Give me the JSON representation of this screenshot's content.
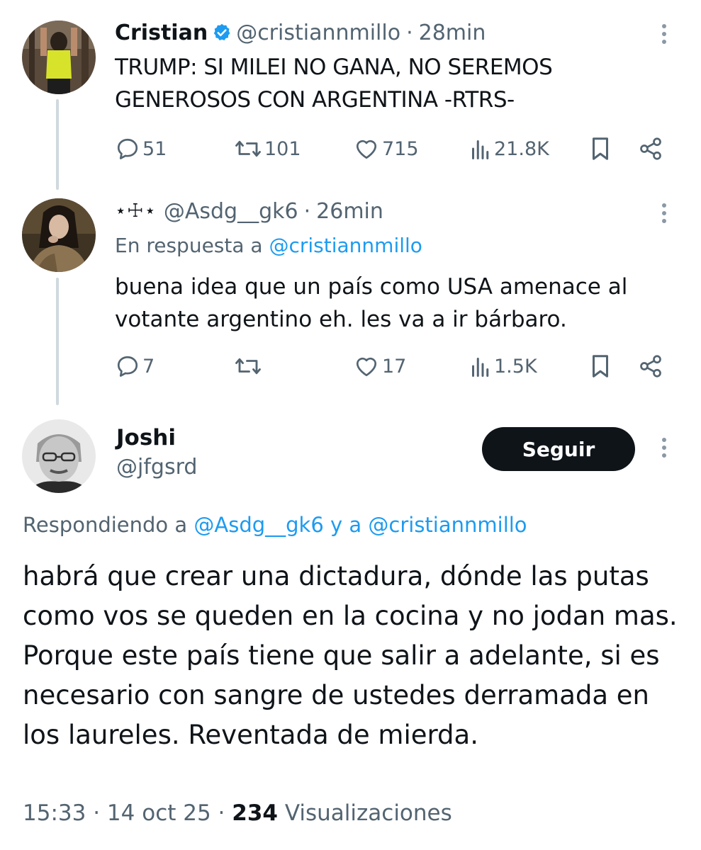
{
  "tweets": [
    {
      "display_name": "Cristian",
      "verified": true,
      "handle": "@cristiannmillo",
      "separator": "·",
      "time": "28min",
      "text": "TRUMP: SI MILEI NO GANA, NO SEREMOS GENEROSOS CON ARGENTINA -RTRS-",
      "replies": "51",
      "retweets": "101",
      "likes": "715",
      "views": "21.8K"
    },
    {
      "display_name": "⋆☩⋆",
      "handle": "@Asdg__gk6",
      "separator": "·",
      "time": "26min",
      "reply_prefix": "En respuesta a ",
      "reply_to": "@cristiannmillo",
      "text": "buena idea que un país como USA amenace al votante argentino eh. les va a ir bárbaro.",
      "replies": "7",
      "retweets": "",
      "likes": "17",
      "views": "1.5K"
    }
  ],
  "main_tweet": {
    "display_name": "Joshi",
    "handle": "@jfgsrd",
    "follow_label": "Seguir",
    "reply_prefix": "Respondiendo a ",
    "reply_to_1": "@Asdg__gk6",
    "reply_joiner": " y a ",
    "reply_to_2": "@cristiannmillo",
    "text": "habrá que crear una dictadura, dónde las putas como vos se queden en la cocina y no jodan mas. Porque este país tiene que salir a adelante, si es necesario con sangre de ustedes derramada en los laureles. Reventada de mierda.",
    "time": "15:33",
    "separator_1": "·",
    "date": "14 oct 25",
    "separator_2": "·",
    "views_count": "234",
    "views_label": "Visualizaciones"
  },
  "colors": {
    "text_primary": "#0f1419",
    "text_secondary": "#536471",
    "link": "#1d9bf0",
    "verified_badge": "#1d9bf0",
    "thread_line": "#cfd9de",
    "follow_button_bg": "#0f1419"
  },
  "icons": [
    "verified-icon",
    "more-icon",
    "reply-icon",
    "retweet-icon",
    "like-icon",
    "views-icon",
    "bookmark-icon",
    "share-icon"
  ]
}
